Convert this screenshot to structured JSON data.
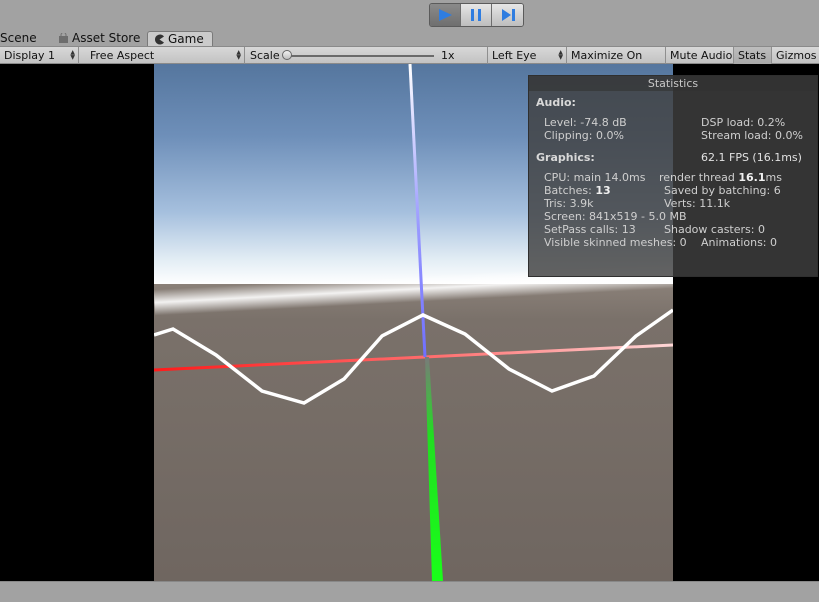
{
  "playbar": {
    "play_icon": "play-icon",
    "pause_icon": "pause-icon",
    "step_icon": "step-icon"
  },
  "tabs": [
    {
      "label": "Scene"
    },
    {
      "label": "Asset Store",
      "icon": "shopping-bag-icon"
    },
    {
      "label": "Game",
      "icon": "pacman-icon"
    }
  ],
  "toolbar": {
    "display": "Display 1",
    "aspect": "Free Aspect",
    "scale_label": "Scale",
    "scale_value": "1x",
    "eye": "Left Eye",
    "maximize": "Maximize On Play",
    "mute": "Mute Audio",
    "stats": "Stats",
    "gizmos": "Gizmos"
  },
  "stats": {
    "title": "Statistics",
    "audio_header": "Audio:",
    "level": "Level: -74.8 dB",
    "clipping": "Clipping: 0.0%",
    "dsp": "DSP load: 0.2%",
    "stream": "Stream load: 0.0%",
    "graphics_header": "Graphics:",
    "fps": "62.1 FPS (16.1ms)",
    "cpu_main": "CPU: main 14.0ms",
    "render_prefix": "render thread ",
    "render_value": "16.1",
    "render_unit": "ms",
    "batches_label": "Batches: ",
    "batches_value": "13",
    "saved_batching": "Saved by batching: 6",
    "tris": "Tris: 3.9k",
    "verts": "Verts: 11.1k",
    "screen": "Screen: 841x519 - 5.0 MB",
    "setpass": "SetPass calls: 13",
    "shadow": "Shadow casters: 0",
    "skinned": "Visible skinned meshes: 0",
    "animations": "Animations: 0"
  },
  "colors": {
    "axis_x": "#ff2a2a",
    "axis_y": "#8a8aff",
    "axis_z": "#22dd22",
    "wave": "#ffffff"
  }
}
